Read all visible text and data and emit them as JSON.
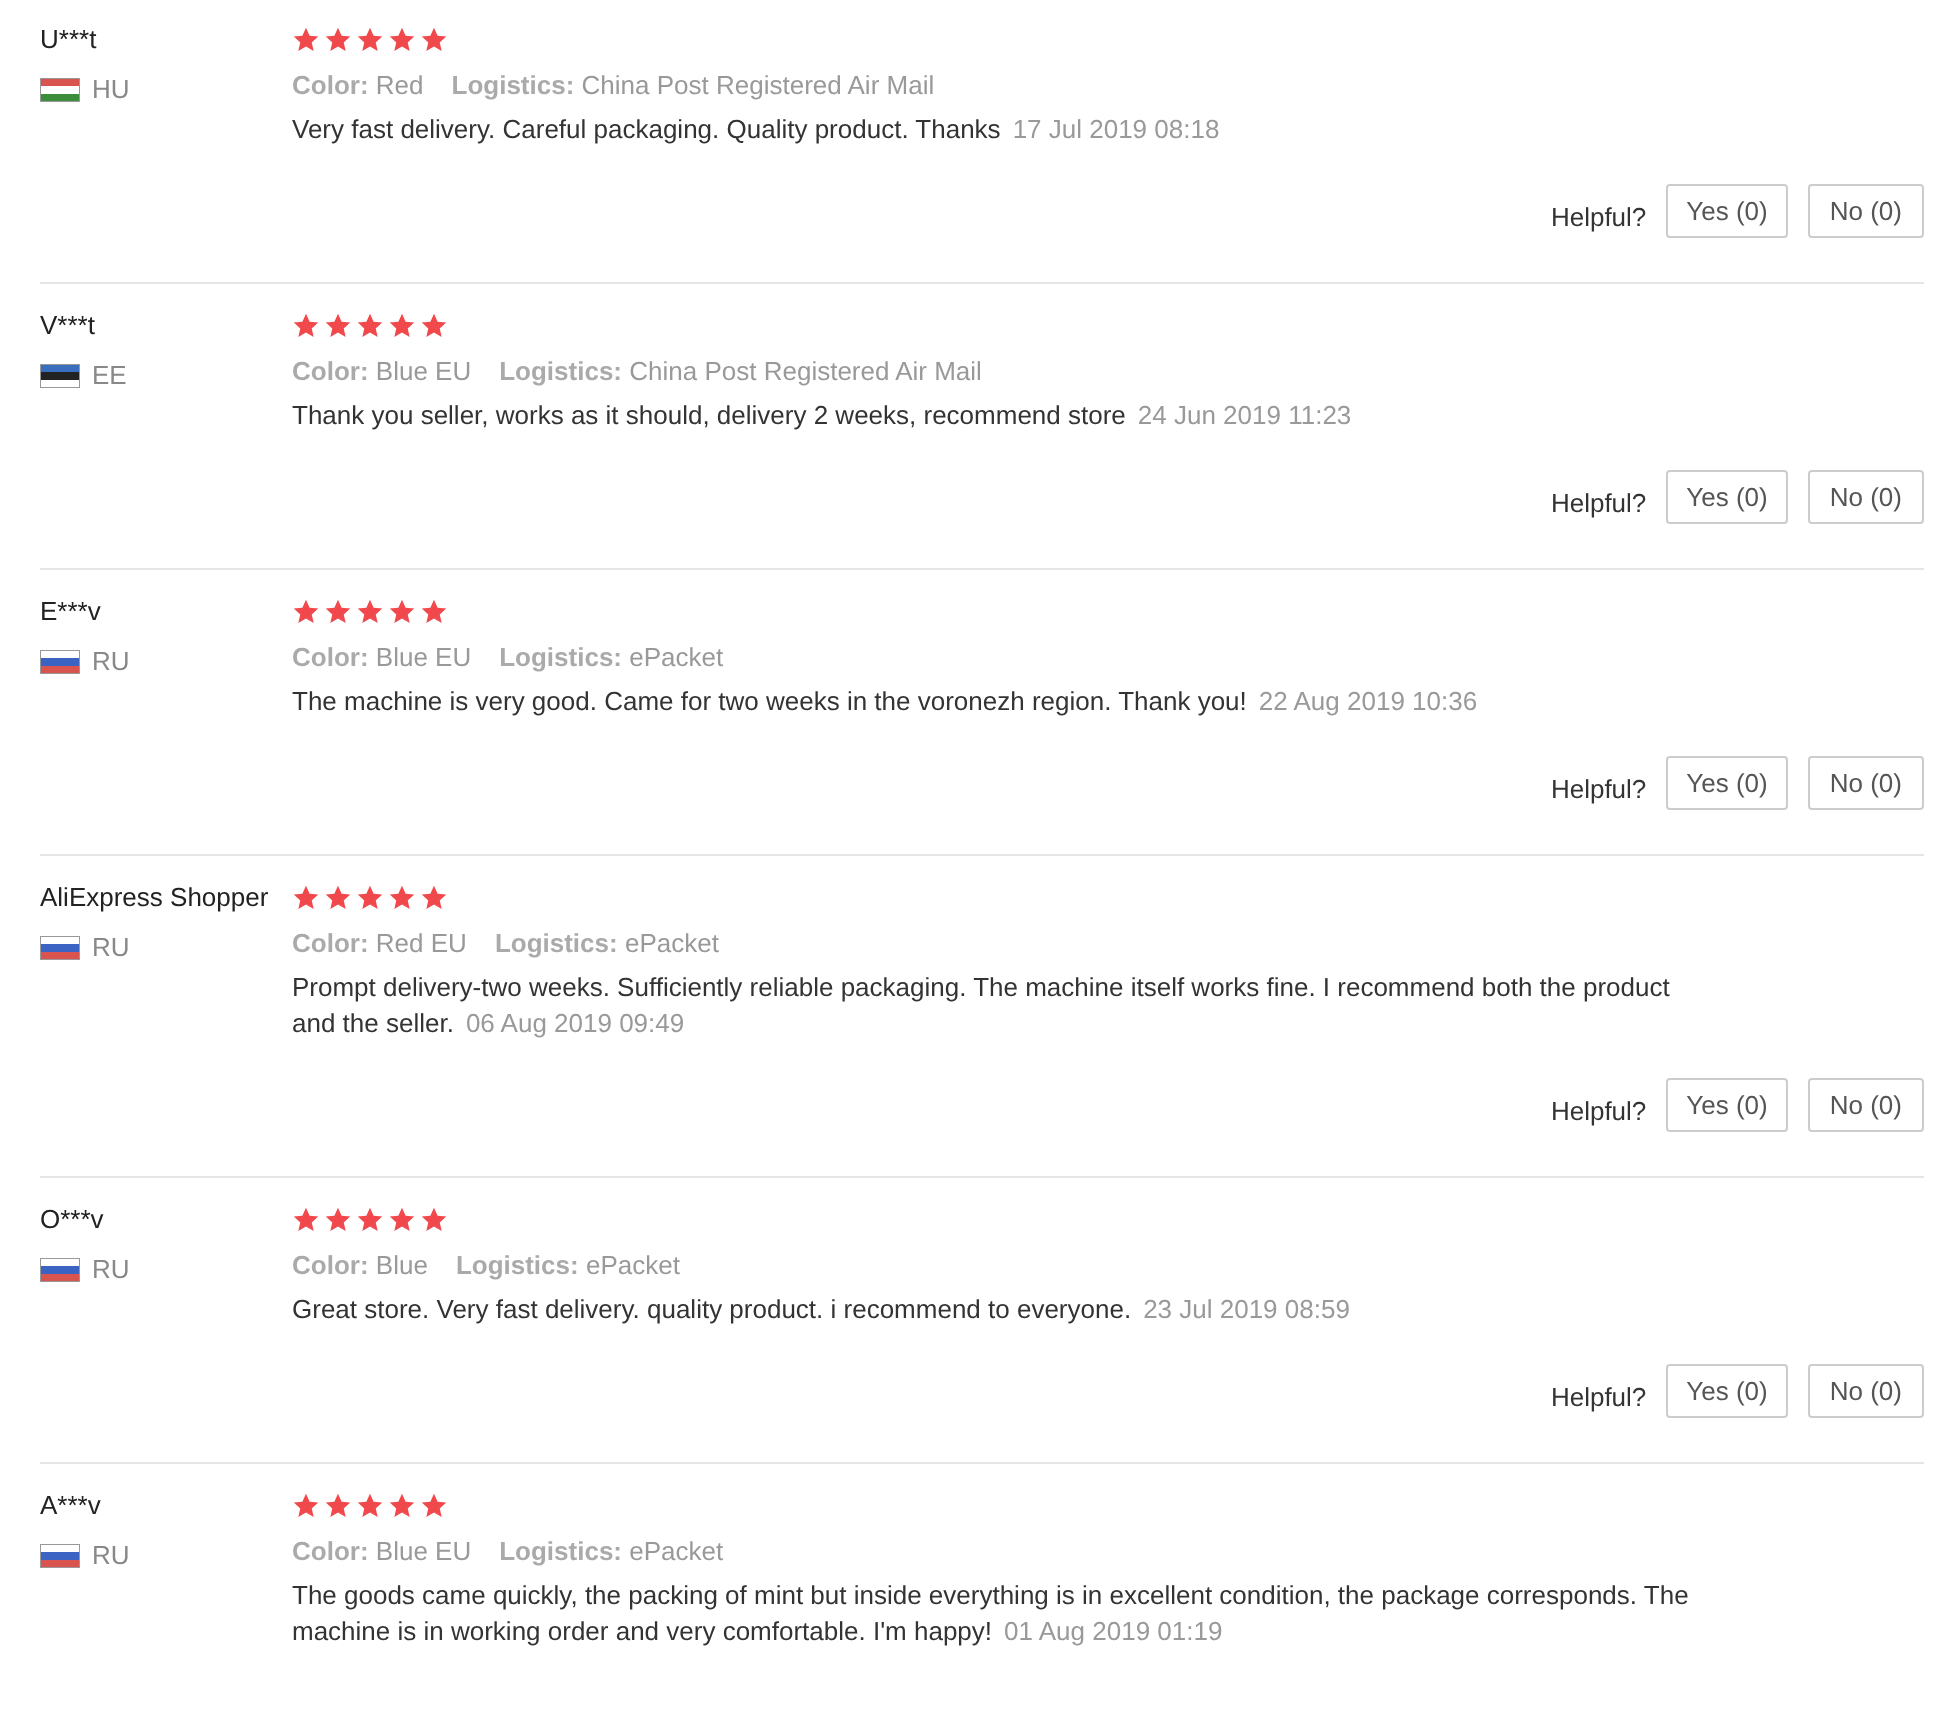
{
  "reviews": [
    {
      "name": "U***t",
      "flag": {
        "kind": "hungary"
      },
      "country": "HU",
      "stars": 5,
      "color_label": "Color:",
      "color_value": "Red",
      "logistics_label": "Logistics:",
      "logistics_value": "China Post Registered Air Mail",
      "text": "Very fast delivery. Careful packaging. Quality product. Thanks",
      "date": "17 Jul 2019 08:18",
      "helpful_label": "Helpful?",
      "yes": "Yes (0)",
      "no": "No (0)"
    },
    {
      "name": "V***t",
      "flag": {
        "kind": "estonia"
      },
      "country": "EE",
      "stars": 5,
      "color_label": "Color:",
      "color_value": "Blue EU",
      "logistics_label": "Logistics:",
      "logistics_value": "China Post Registered Air Mail",
      "text": "Thank you seller, works as it should, delivery 2 weeks, recommend store",
      "date": "24 Jun 2019 11:23",
      "helpful_label": "Helpful?",
      "yes": "Yes (0)",
      "no": "No (0)"
    },
    {
      "name": "E***v",
      "flag": {
        "kind": "russia"
      },
      "country": "RU",
      "stars": 5,
      "color_label": "Color:",
      "color_value": "Blue EU",
      "logistics_label": "Logistics:",
      "logistics_value": "ePacket",
      "text": "The machine is very good. Came for two weeks in the voronezh region. Thank you!",
      "date": "22 Aug 2019 10:36",
      "helpful_label": "Helpful?",
      "yes": "Yes (0)",
      "no": "No (0)"
    },
    {
      "name": "AliExpress Shopper",
      "flag": {
        "kind": "russia"
      },
      "country": "RU",
      "stars": 5,
      "color_label": "Color:",
      "color_value": "Red EU",
      "logistics_label": "Logistics:",
      "logistics_value": "ePacket",
      "text": "Prompt delivery-two weeks. Sufficiently reliable packaging. The machine itself works fine. I recommend both the product and the seller.",
      "date": "06 Aug 2019 09:49",
      "helpful_label": "Helpful?",
      "yes": "Yes (0)",
      "no": "No (0)"
    },
    {
      "name": "O***v",
      "flag": {
        "kind": "russia"
      },
      "country": "RU",
      "stars": 5,
      "color_label": "Color:",
      "color_value": "Blue",
      "logistics_label": "Logistics:",
      "logistics_value": "ePacket",
      "text": "Great store. Very fast delivery. quality product. i recommend to everyone.",
      "date": "23 Jul 2019 08:59",
      "helpful_label": "Helpful?",
      "yes": "Yes (0)",
      "no": "No (0)"
    },
    {
      "name": "A***v",
      "flag": {
        "kind": "russia"
      },
      "country": "RU",
      "stars": 5,
      "color_label": "Color:",
      "color_value": "Blue EU",
      "logistics_label": "Logistics:",
      "logistics_value": "ePacket",
      "text": "The goods came quickly, the packing of mint but inside everything is in excellent condition, the package corresponds. The machine is in working order and very comfortable. I'm happy!",
      "date": "01 Aug 2019 01:19"
    }
  ]
}
